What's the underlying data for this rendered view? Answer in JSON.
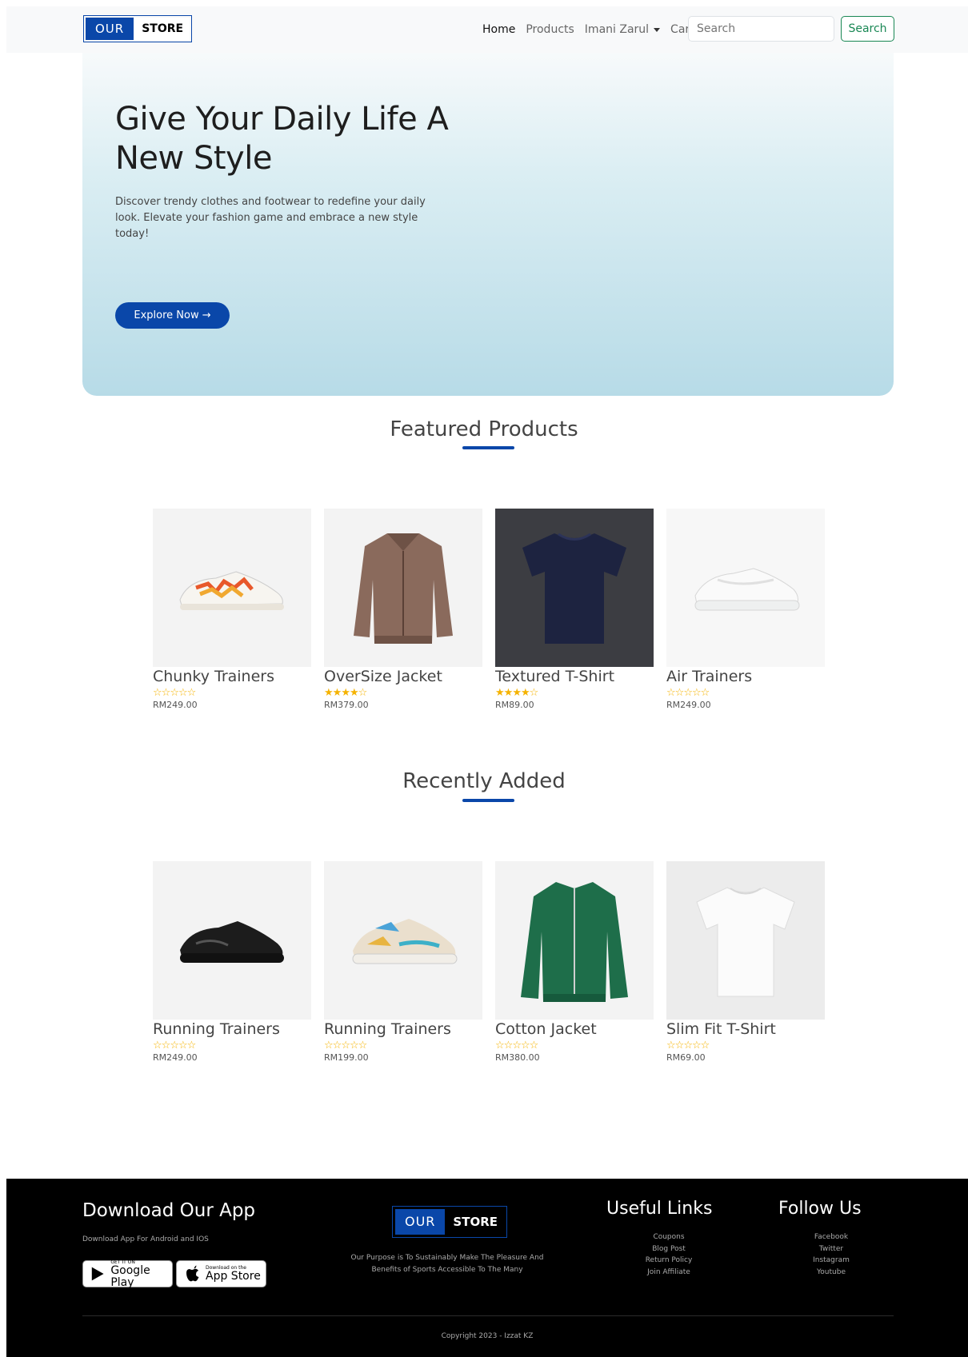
{
  "navbar": {
    "logo_our": "OUR",
    "logo_store": "STORE",
    "links": {
      "home": "Home",
      "products": "Products",
      "user": "Imani Zarul",
      "cart": "Cart"
    },
    "search_placeholder": "Search",
    "search_button": "Search"
  },
  "hero": {
    "title": "Give Your Daily Life A New Style",
    "description": "Discover trendy clothes and footwear to redefine your daily look. Elevate your fashion game and embrace a new style today!",
    "cta": "Explore Now →"
  },
  "featured": {
    "title": "Featured Products",
    "products": [
      {
        "name": "Chunky Trainers",
        "rating": 0,
        "price": "RM249.00"
      },
      {
        "name": "OverSize Jacket",
        "rating": 4,
        "price": "RM379.00"
      },
      {
        "name": "Textured T-Shirt",
        "rating": 4,
        "price": "RM89.00"
      },
      {
        "name": "Air Trainers",
        "rating": 0,
        "price": "RM249.00"
      }
    ]
  },
  "recent": {
    "title": "Recently Added",
    "products": [
      {
        "name": "Running Trainers",
        "rating": 0,
        "price": "RM249.00"
      },
      {
        "name": "Running Trainers",
        "rating": 0,
        "price": "RM199.00"
      },
      {
        "name": "Cotton Jacket",
        "rating": 0,
        "price": "RM380.00"
      },
      {
        "name": "Slim Fit T-Shirt",
        "rating": 0,
        "price": "RM69.00"
      }
    ]
  },
  "footer": {
    "app_title": "Download Our App",
    "app_subtitle": "Download App For Android and IOS",
    "google_small": "GET IT ON",
    "google_big": "Google Play",
    "apple_small": "Download on the",
    "apple_big": "App Store",
    "logo_our": "OUR",
    "logo_store": "STORE",
    "purpose": "Our Purpose is To Sustainably Make The Pleasure And Benefits of Sports Accessible To The Many",
    "useful_title": "Useful Links",
    "useful_links": [
      "Coupons",
      "Blog Post",
      "Return Policy",
      "Join Affiliate"
    ],
    "follow_title": "Follow Us",
    "follow_links": [
      "Facebook",
      "Twitter",
      "Instagram",
      "Youtube"
    ],
    "copyright": "Copyright 2023 - Izzat KZ"
  },
  "colors": {
    "brand": "#0a47a9",
    "star": "#f5b301",
    "search_button": "#198754"
  }
}
